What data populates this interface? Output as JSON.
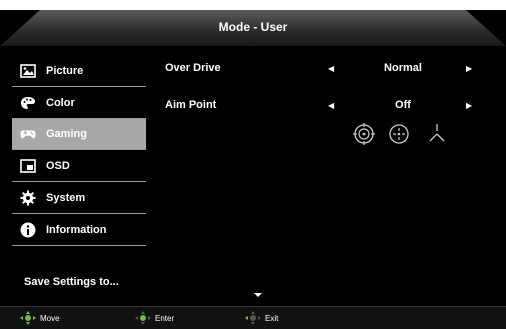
{
  "header": {
    "title": "Mode - User"
  },
  "sidebar": {
    "items": [
      {
        "label": "Picture",
        "icon": "picture-icon"
      },
      {
        "label": "Color",
        "icon": "palette-icon"
      },
      {
        "label": "Gaming",
        "icon": "gamepad-icon",
        "active": true
      },
      {
        "label": "OSD",
        "icon": "osd-icon"
      },
      {
        "label": "System",
        "icon": "gear-icon"
      },
      {
        "label": "Information",
        "icon": "info-icon"
      }
    ],
    "save_label": "Save Settings to..."
  },
  "settings": [
    {
      "label": "Over Drive",
      "value": "Normal"
    },
    {
      "label": "Aim Point",
      "value": "Off"
    }
  ],
  "footer": {
    "move": "Move",
    "enter": "Enter",
    "exit": "Exit"
  },
  "colors": {
    "active": "#a8a8a8",
    "accent": "#7ab648",
    "background": "#000000"
  }
}
